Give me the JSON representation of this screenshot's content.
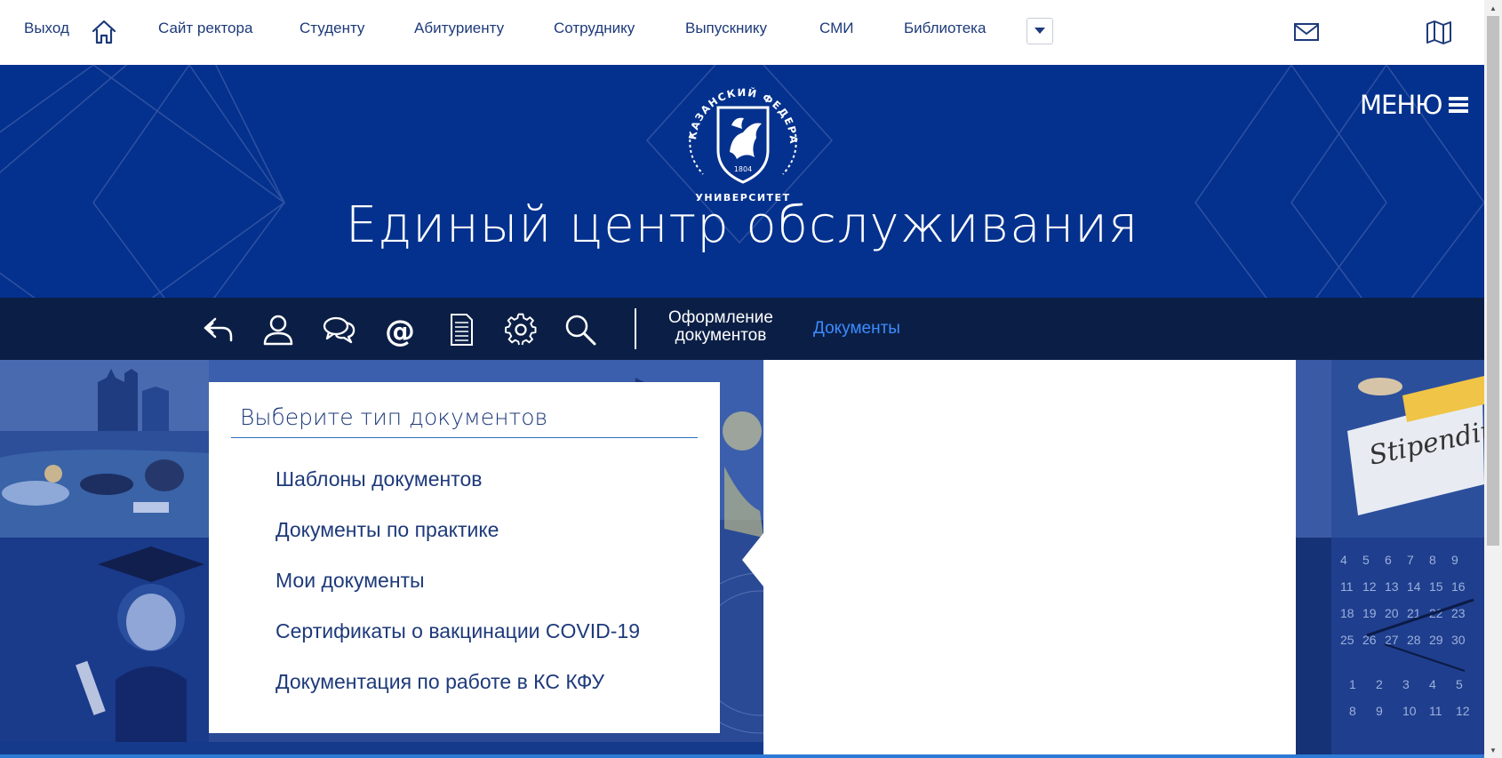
{
  "topnav": {
    "logout_label": "Выход",
    "items": [
      "Сайт ректора",
      "Студенту",
      "Абитуриенту",
      "Сотруднику",
      "Выпускнику",
      "СМИ",
      "Библиотека"
    ],
    "icons": [
      "home-icon",
      "chevron-down-icon",
      "mail-icon",
      "map-icon"
    ]
  },
  "banner": {
    "logo_text": "КАЗАНСКИЙ ФЕДЕРАЛЬНЫЙ УНИВЕРСИТЕТ",
    "logo_year": "1804",
    "title": "Единый центр обслуживания",
    "menu_label": "МЕНЮ"
  },
  "toolbar": {
    "icons": [
      "back-arrow-icon",
      "user-icon",
      "chat-icon",
      "at-icon",
      "document-icon",
      "gear-icon",
      "search-icon"
    ],
    "link_docs_service_line1": "Оформление",
    "link_docs_service_line2": "документов",
    "link_documents": "Документы"
  },
  "documents_panel": {
    "heading": "Выберите тип документов",
    "items": [
      "Шаблоны документов",
      "Документы по практике",
      "Мои документы",
      "Сертификаты о вакцинации COVID-19",
      "Документация по работе в КС КФУ"
    ]
  },
  "images": {
    "stipend_sign": "Stipendiu"
  },
  "colors": {
    "banner_bg": "#04318d",
    "toolbar_bg": "#0b1f46",
    "link_active": "#3d8bff",
    "text_primary": "#1d3a7a"
  }
}
